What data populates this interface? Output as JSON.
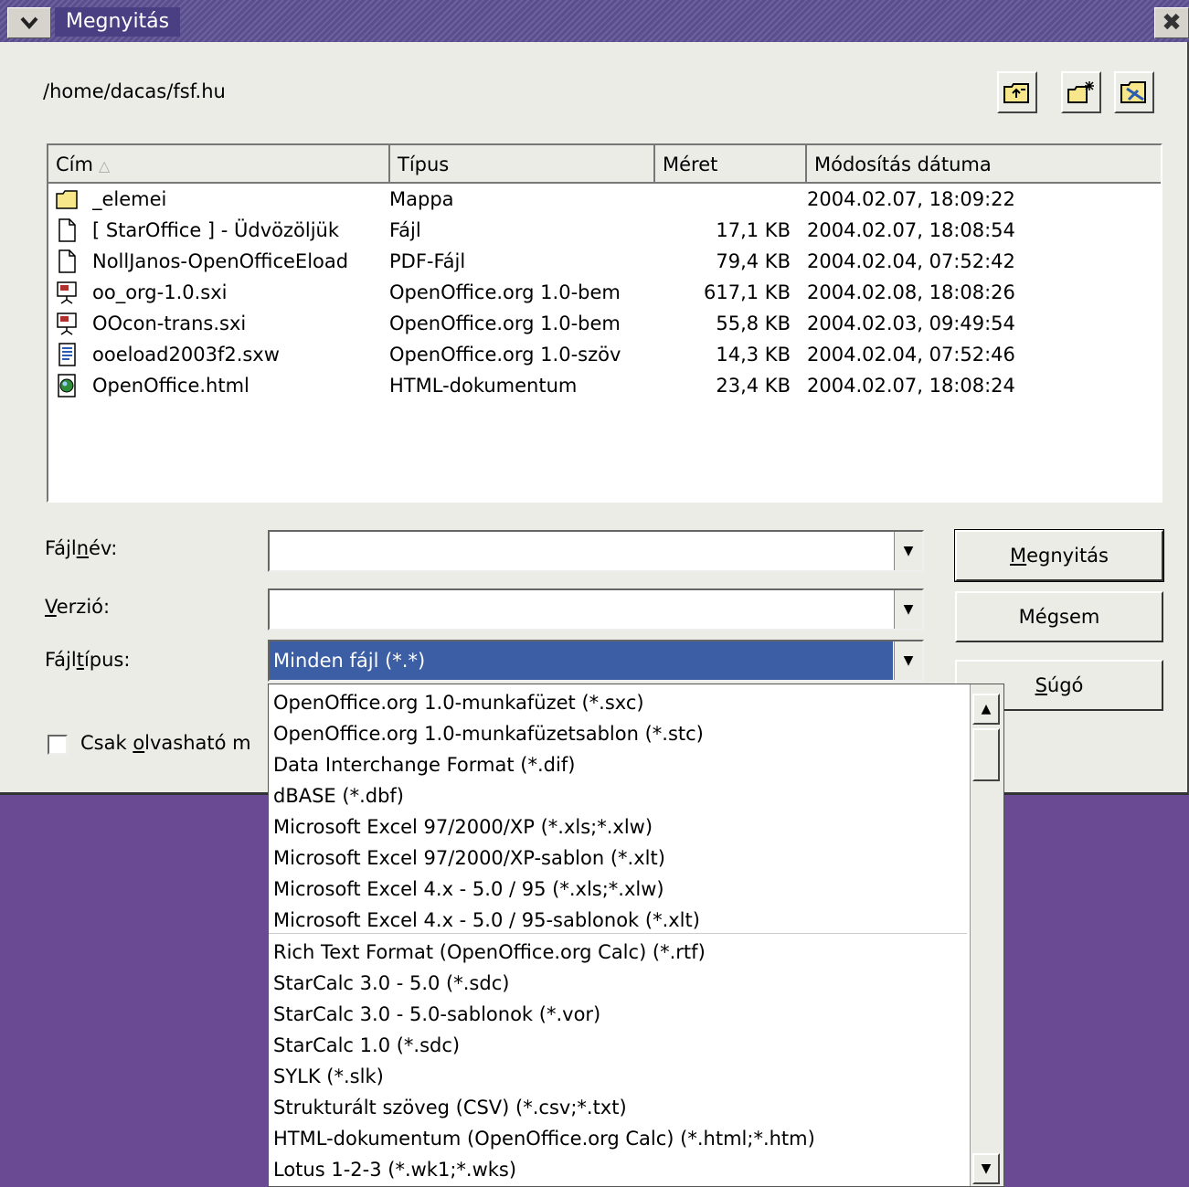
{
  "window": {
    "title": "Megnyitás",
    "close_glyph": "✖",
    "menu_glyph": "▼"
  },
  "path": "/home/dacas/fsf.hu",
  "toolbar": {
    "icons": [
      "folder-up-icon",
      "new-folder-icon",
      "default-directory-icon"
    ]
  },
  "columns": {
    "name": "Cím",
    "type": "Típus",
    "size": "Méret",
    "date": "Módosítás dátuma",
    "sort_glyph": "△"
  },
  "files": [
    {
      "icon": "folder-icon",
      "name": "_elemei",
      "type": "Mappa",
      "size": "",
      "date": "2004.02.07, 18:09:22"
    },
    {
      "icon": "document-icon",
      "name": "[ StarOffice ] - Üdvözöljük",
      "type": "Fájl",
      "size": "17,1 KB",
      "date": "2004.02.07, 18:08:54"
    },
    {
      "icon": "document-icon",
      "name": "NollJanos-OpenOfficeEload",
      "type": "PDF-Fájl",
      "size": "79,4 KB",
      "date": "2004.02.04, 07:52:42"
    },
    {
      "icon": "presentation-icon",
      "name": "oo_org-1.0.sxi",
      "type": "OpenOffice.org 1.0-bem",
      "size": "617,1 KB",
      "date": "2004.02.08, 18:08:26"
    },
    {
      "icon": "presentation-icon",
      "name": "OOcon-trans.sxi",
      "type": "OpenOffice.org 1.0-bem",
      "size": "55,8 KB",
      "date": "2004.02.03, 09:49:54"
    },
    {
      "icon": "text-document-icon",
      "name": "ooeload2003f2.sxw",
      "type": "OpenOffice.org 1.0-szöv",
      "size": "14,3 KB",
      "date": "2004.02.04, 07:52:46"
    },
    {
      "icon": "html-icon",
      "name": "OpenOffice.html",
      "type": "HTML-dokumentum",
      "size": "23,4 KB",
      "date": "2004.02.07, 18:08:24"
    }
  ],
  "form": {
    "filename": {
      "label_pre": "Fájl",
      "label_key": "n",
      "label_post": "év:",
      "value": ""
    },
    "version": {
      "label_pre": "",
      "label_key": "V",
      "label_post": "erzió:",
      "value": ""
    },
    "filetype": {
      "label_pre": "Fájl",
      "label_key": "t",
      "label_post": "ípus:",
      "value": "Minden fájl (*.*)"
    },
    "readonly": {
      "label_pre": "Csak ",
      "label_key": "o",
      "label_post": "lvasható m"
    }
  },
  "buttons": {
    "open": {
      "key": "M",
      "rest": "egnyitás"
    },
    "cancel": "Mégsem",
    "help": {
      "key": "S",
      "rest": "úgó"
    }
  },
  "filetype_options": [
    "OpenOffice.org 1.0-munkafüzet (*.sxc)",
    "OpenOffice.org 1.0-munkafüzetsablon (*.stc)",
    "Data Interchange Format (*.dif)",
    "dBASE (*.dbf)",
    "Microsoft Excel 97/2000/XP (*.xls;*.xlw)",
    "Microsoft Excel 97/2000/XP-sablon (*.xlt)",
    "Microsoft Excel 4.x - 5.0 / 95 (*.xls;*.xlw)",
    "Microsoft Excel 4.x - 5.0 / 95-sablonok (*.xlt)",
    "Rich Text Format (OpenOffice.org Calc) (*.rtf)",
    "StarCalc 3.0 - 5.0 (*.sdc)",
    "StarCalc 3.0 - 5.0-sablonok (*.vor)",
    "StarCalc 1.0 (*.sdc)",
    "SYLK (*.slk)",
    "Strukturált szöveg (CSV) (*.csv;*.txt)",
    "HTML-dokumentum (OpenOffice.org Calc) (*.html;*.htm)",
    "Lotus 1-2-3 (*.wk1;*.wks)"
  ],
  "colors": {
    "desktop": "#6b4a94",
    "selection": "#3c5ea4",
    "titlebar": "#5a4f8c"
  }
}
